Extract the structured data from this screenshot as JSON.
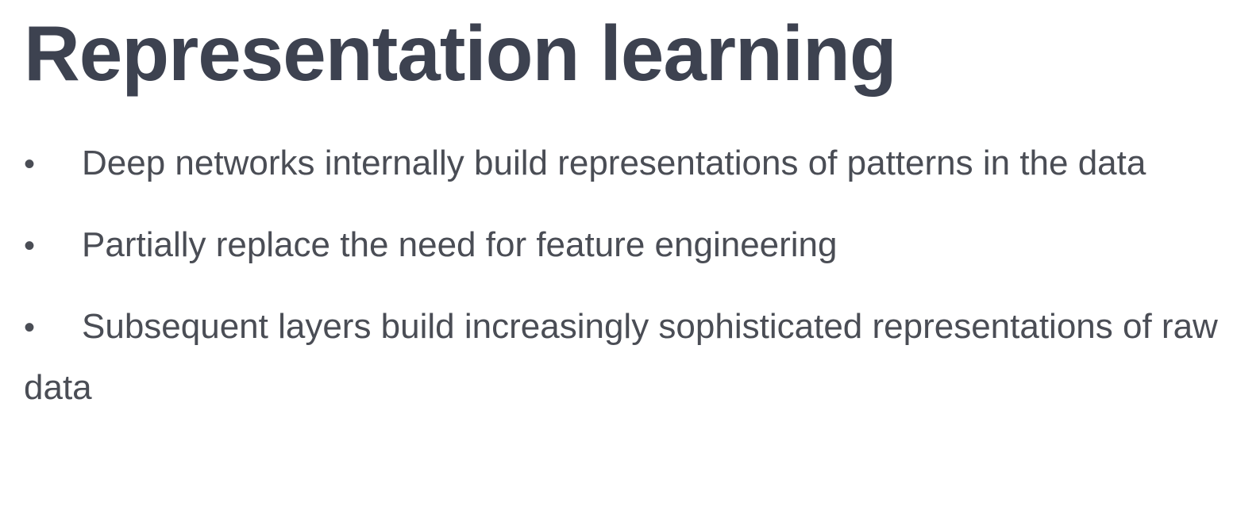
{
  "slide": {
    "title": "Representation learning",
    "bullet_symbol": "•",
    "bullets": [
      {
        "text": "Deep networks internally build representations of patterns in the data"
      },
      {
        "text": "Partially replace the need for feature engineering"
      },
      {
        "text": "Subsequent layers build increasingly sophisticated representations of raw data"
      }
    ]
  },
  "colors": {
    "title": "#3d4250",
    "body_text": "#4a4d55",
    "background": "#ffffff"
  }
}
